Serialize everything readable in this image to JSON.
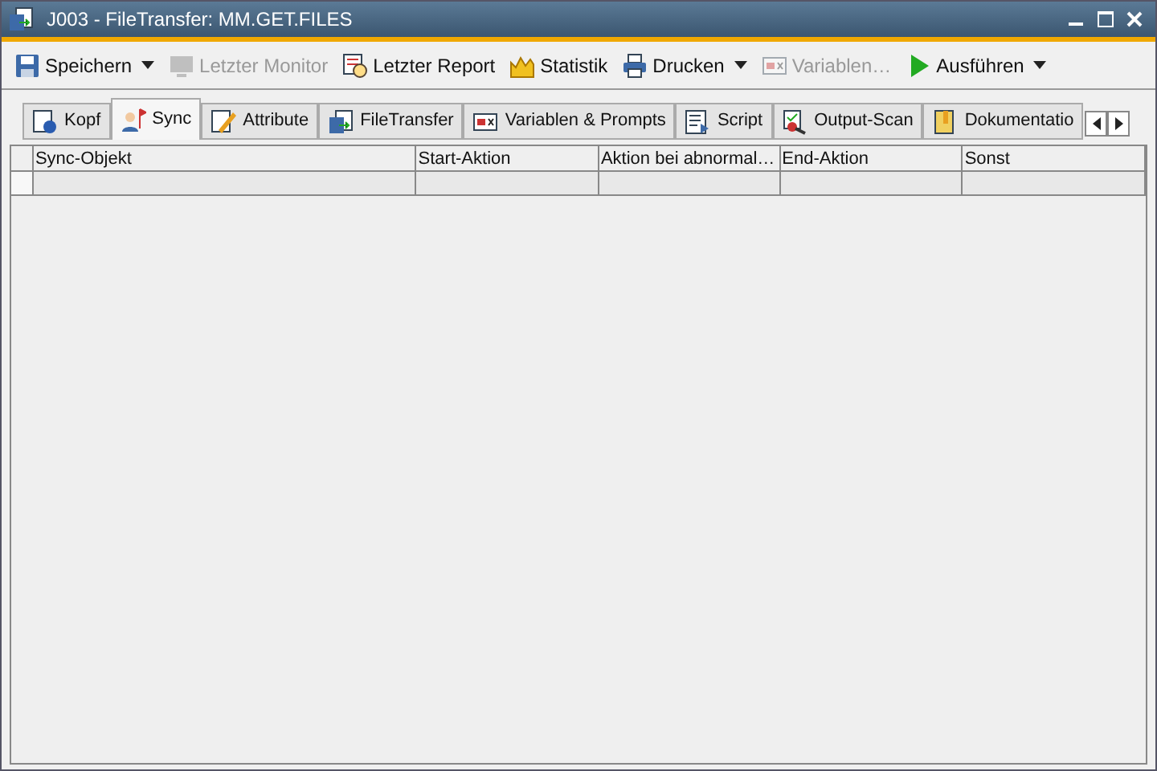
{
  "window": {
    "title": "J003 - FileTransfer: MM.GET.FILES"
  },
  "toolbar": [
    {
      "label": "Speichern",
      "kind": "save",
      "disabled": false,
      "dropdown": true
    },
    {
      "label": "Letzter Monitor",
      "kind": "monitor",
      "disabled": true,
      "dropdown": false
    },
    {
      "label": "Letzter Report",
      "kind": "report",
      "disabled": false,
      "dropdown": false
    },
    {
      "label": "Statistik",
      "kind": "chart",
      "disabled": false,
      "dropdown": false
    },
    {
      "label": "Drucken",
      "kind": "print",
      "disabled": false,
      "dropdown": true
    },
    {
      "label": "Variablen…",
      "kind": "vars",
      "disabled": true,
      "dropdown": false
    },
    {
      "label": "Ausführen",
      "kind": "play",
      "disabled": false,
      "dropdown": true
    }
  ],
  "tabs": [
    {
      "label": "Kopf",
      "kind": "info",
      "selected": false
    },
    {
      "label": "Sync",
      "kind": "person",
      "selected": true
    },
    {
      "label": "Attribute",
      "kind": "pencil",
      "selected": false
    },
    {
      "label": "FileTransfer",
      "kind": "file",
      "selected": false
    },
    {
      "label": "Variablen & Prompts",
      "kind": "vars",
      "selected": false
    },
    {
      "label": "Script",
      "kind": "script",
      "selected": false
    },
    {
      "label": "Output-Scan",
      "kind": "scan",
      "selected": false
    },
    {
      "label": "Dokumentatio",
      "kind": "doc",
      "selected": false
    }
  ],
  "table": {
    "columns": [
      "Sync-Objekt",
      "Start-Aktion",
      "Aktion bei abnormal…",
      "End-Aktion",
      "Sonst"
    ]
  }
}
